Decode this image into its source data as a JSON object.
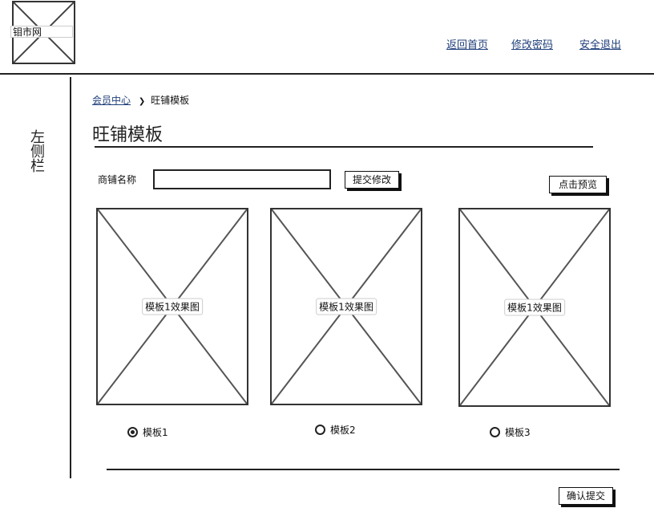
{
  "header": {
    "logo_text": "钼市网",
    "nav": [
      {
        "label": "返回首页"
      },
      {
        "label": "修改密码"
      },
      {
        "label": "安全退出"
      }
    ]
  },
  "sidebar": {
    "label": "左侧栏"
  },
  "breadcrumb": {
    "parent": "会员中心",
    "separator": "❯",
    "current": "旺铺模板"
  },
  "page": {
    "title": "旺铺模板"
  },
  "form": {
    "shop_name_label": "商铺名称",
    "shop_name_value": "",
    "submit_change_label": "提交修改",
    "preview_label": "点击预览"
  },
  "templates": [
    {
      "image_label": "模板1效果图",
      "radio_label": "模板1",
      "selected": true
    },
    {
      "image_label": "模板1效果图",
      "radio_label": "模板2",
      "selected": false
    },
    {
      "image_label": "模板1效果图",
      "radio_label": "模板3",
      "selected": false
    }
  ],
  "footer": {
    "confirm_label": "确认提交"
  }
}
